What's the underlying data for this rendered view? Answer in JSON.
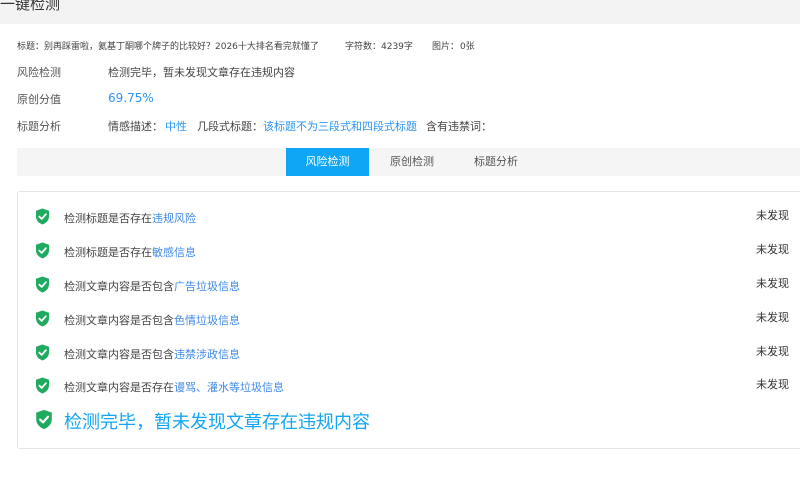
{
  "header": {
    "title": "一键检测"
  },
  "info": {
    "title_label": "标题：",
    "title_value": "别再踩雷啦，氦基丁酮哪个牌子的比较好？2026十大排名看完就懂了",
    "chars_label": "字符数：",
    "chars_value": "4239字",
    "images_label": "图片：",
    "images_value": "0张"
  },
  "risk": {
    "label": "风险检测",
    "value": "检测完毕，暂未发现文章存在违规内容"
  },
  "originality": {
    "label": "原创分值",
    "value": "69.75%"
  },
  "title_analysis": {
    "label": "标题分析",
    "sentiment_label": "情感描述：",
    "sentiment_value": "中性",
    "segments_label": "几段式标题：",
    "segments_value": "该标题不为三段式和四段式标题",
    "banned_label": "含有违禁词："
  },
  "tabs": [
    {
      "label": "风险检测",
      "active": true
    },
    {
      "label": "原创检测",
      "active": false
    },
    {
      "label": "标题分析",
      "active": false
    }
  ],
  "checks": [
    {
      "prefix": "检测标题是否存在",
      "link": "违规风险",
      "status": "未发现"
    },
    {
      "prefix": "检测标题是否存在",
      "link": "敏感信息",
      "status": "未发现"
    },
    {
      "prefix": "检测文章内容是否包含",
      "link": "广告垃圾信息",
      "status": "未发现"
    },
    {
      "prefix": "检测文章内容是否包含",
      "link": "色情垃圾信息",
      "status": "未发现"
    },
    {
      "prefix": "检测文章内容是否包含",
      "link": "违禁涉政信息",
      "status": "未发现"
    },
    {
      "prefix": "检测文章内容是否存在",
      "link": "谩骂、灌水等垃圾信息",
      "status": "未发现"
    }
  ],
  "summary": {
    "text": "检测完毕，暂未发现文章存在违规内容"
  },
  "colors": {
    "accent": "#0fa6f5",
    "shield": "#1faa5f",
    "link": "#3f8ae8"
  },
  "icons": {
    "check_row": "shield-check-icon",
    "summary": "shield-check-icon"
  }
}
